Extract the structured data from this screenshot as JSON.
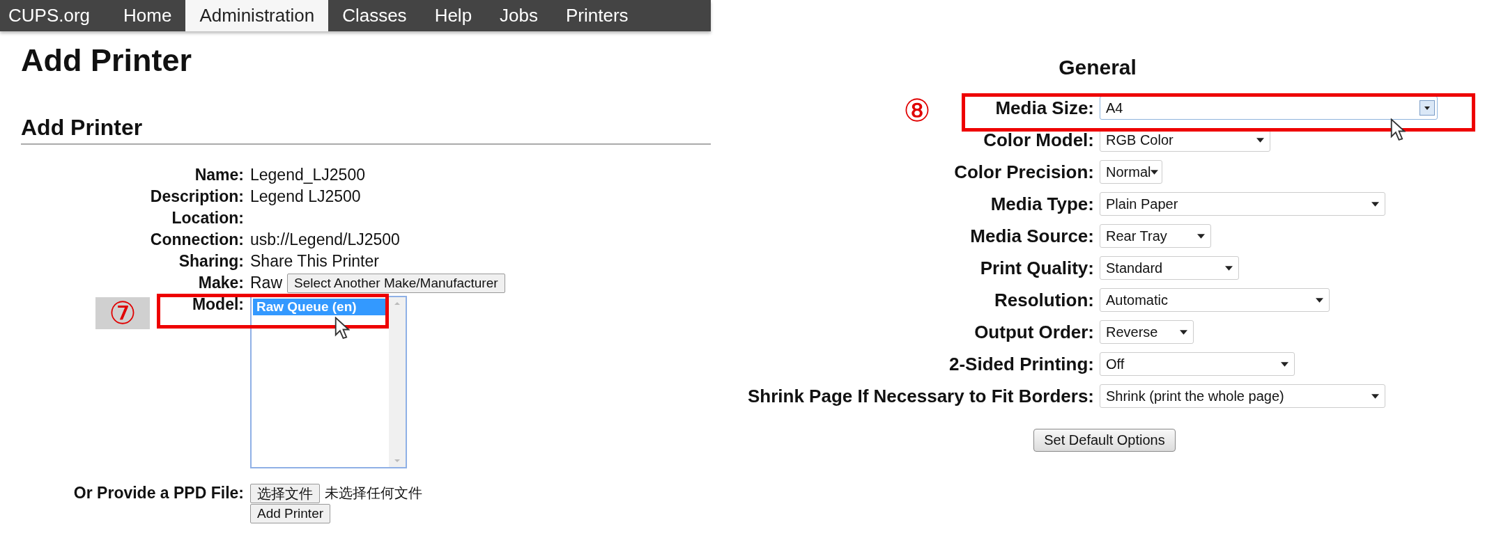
{
  "nav": [
    {
      "label": "CUPS.org",
      "selected": false
    },
    {
      "label": "Home",
      "selected": false
    },
    {
      "label": "Administration",
      "selected": true
    },
    {
      "label": "Classes",
      "selected": false
    },
    {
      "label": "Help",
      "selected": false
    },
    {
      "label": "Jobs",
      "selected": false
    },
    {
      "label": "Printers",
      "selected": false
    }
  ],
  "page_title": "Add Printer",
  "section_title": "Add Printer",
  "fields": [
    {
      "label": "Name:",
      "value": "Legend_LJ2500"
    },
    {
      "label": "Description:",
      "value": "Legend LJ2500"
    },
    {
      "label": "Location:"
    },
    {
      "label": "Connection:",
      "value": "usb://Legend/LJ2500"
    },
    {
      "label": "Sharing:",
      "value": "Share This Printer"
    }
  ],
  "make": {
    "label": "Make:",
    "value": "Raw",
    "button": "Select Another Make/Manufacturer"
  },
  "model": {
    "label": "Model:",
    "options": [
      {
        "label": "Raw Queue (en)",
        "selected": true
      }
    ]
  },
  "ppd": {
    "label": "Or Provide a PPD File:",
    "button": "选择文件",
    "status": "未选择任何文件"
  },
  "submit": "Add Printer",
  "options": {
    "title": "General",
    "rows": [
      {
        "label": "Media Size:",
        "value": "A4",
        "focused": true
      },
      {
        "label": "Color Model:",
        "value": "RGB Color",
        "focused": false
      },
      {
        "label": "Color Precision:",
        "value": "Normal",
        "focused": false
      },
      {
        "label": "Media Type:",
        "value": "Plain Paper",
        "focused": false
      },
      {
        "label": "Media Source:",
        "value": "Rear Tray",
        "focused": false
      },
      {
        "label": "Print Quality:",
        "value": "Standard",
        "focused": false
      },
      {
        "label": "Resolution:",
        "value": "Automatic",
        "focused": false
      },
      {
        "label": "Output Order:",
        "value": "Reverse",
        "focused": false
      },
      {
        "label": "2-Sided Printing:",
        "value": "Off",
        "focused": false
      },
      {
        "label": "Shrink Page If Necessary to Fit Borders:",
        "value": "Shrink (print the whole page)",
        "focused": false
      }
    ],
    "button": "Set Default Options"
  },
  "annotations": [
    {
      "label": "⑦"
    },
    {
      "label": "⑧"
    }
  ]
}
